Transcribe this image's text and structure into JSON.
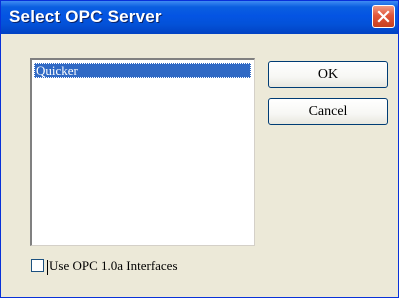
{
  "window": {
    "title": "Select OPC Server",
    "close_icon": "close-x-icon"
  },
  "server_list": {
    "items": [
      "Quicker"
    ],
    "selected_index": 0
  },
  "buttons": {
    "ok_label": "OK",
    "cancel_label": "Cancel"
  },
  "options": {
    "use_opc10a_label": "Use OPC 1.0a Interfaces",
    "use_opc10a_checked": false
  },
  "colors": {
    "titlebar": "#0454e3",
    "selection": "#316ac5",
    "dialog_bg": "#ece9d8",
    "close_button": "#e1563a"
  }
}
